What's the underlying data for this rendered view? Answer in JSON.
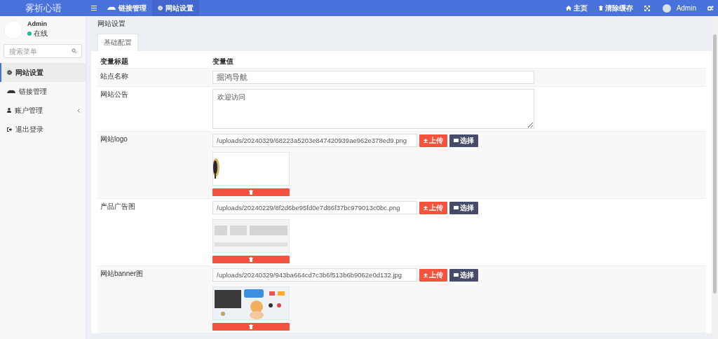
{
  "app": {
    "logo": "雾祈心语"
  },
  "topbar": {
    "tabs": [
      {
        "label": "链接管理",
        "selected": false
      },
      {
        "label": "网站设置",
        "selected": true
      }
    ],
    "actions": [
      {
        "label": "主页"
      },
      {
        "label": "清除缓存"
      }
    ],
    "user": "Admin"
  },
  "sidebar": {
    "user": {
      "name": "Admin",
      "status": "在线"
    },
    "search": {
      "placeholder": "搜索菜单"
    },
    "items": [
      {
        "label": "网站设置",
        "selected": true,
        "expandable": false
      },
      {
        "label": "链接管理",
        "selected": false,
        "expandable": false
      },
      {
        "label": "账户管理",
        "selected": false,
        "expandable": true
      },
      {
        "label": "退出登录",
        "selected": false,
        "expandable": false
      }
    ]
  },
  "page": {
    "title": "网站设置",
    "tabs": [
      {
        "label": "基础配置",
        "selected": true
      }
    ],
    "table": {
      "columns": [
        "变量标题",
        "变量值"
      ],
      "rows": [
        {
          "kind": "text",
          "label": "站点名称",
          "value": "掘鸿导航"
        },
        {
          "kind": "textarea",
          "label": "网站公告",
          "value": "欢迎访问"
        },
        {
          "label": "网站logo",
          "value": "/uploads/20240329/68223a5203e847420939ae962e378ed9.png",
          "upload": "上传",
          "choose": "选择"
        },
        {
          "label": "产品广告图",
          "value": "/uploads/20240229/8f2d6be95fd0e7d86f37bc979013c0bc.png",
          "upload": "上传",
          "choose": "选择"
        },
        {
          "label": "网站banner图",
          "value": "/uploads/20240329/943ba664cd7c3b6f513b6b9062e0d132.jpg",
          "upload": "上传",
          "choose": "选择"
        }
      ]
    }
  }
}
